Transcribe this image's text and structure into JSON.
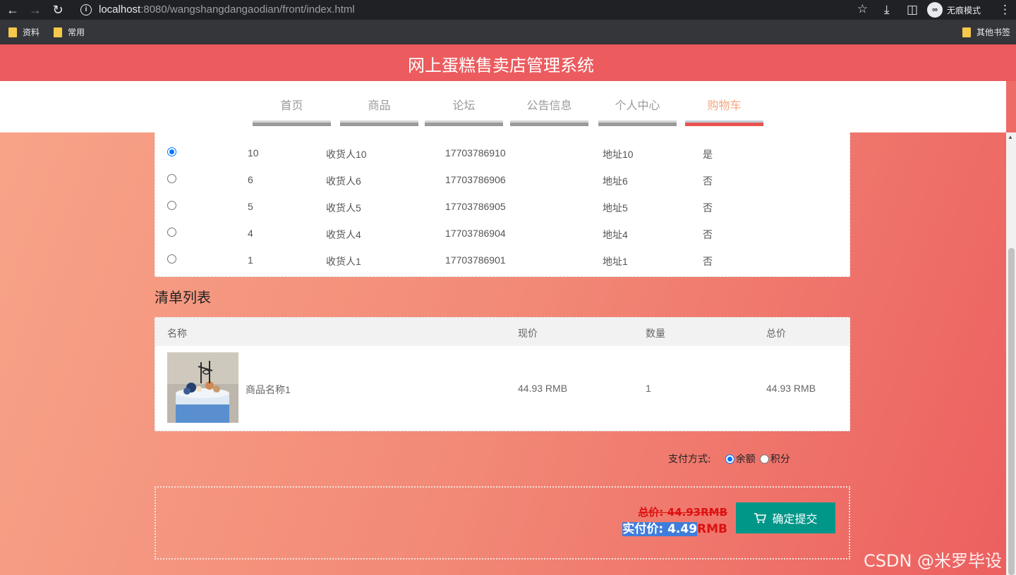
{
  "browser": {
    "url_host": "localhost",
    "url_path": ":8080/wangshangdangaodian/front/index.html",
    "incognito_label": "无痕模式",
    "bookmarks": [
      "资料",
      "常用"
    ],
    "other_bookmarks": "其他书签"
  },
  "site": {
    "title": "网上蛋糕售卖店管理系统",
    "nav": [
      "首页",
      "商品",
      "论坛",
      "公告信息",
      "个人中心",
      "购物车"
    ],
    "active_nav": "购物车"
  },
  "addresses": [
    {
      "id": "10",
      "name": "收货人10",
      "phone": "17703786910",
      "address": "地址10",
      "default": "是",
      "selected": true
    },
    {
      "id": "6",
      "name": "收货人6",
      "phone": "17703786906",
      "address": "地址6",
      "default": "否",
      "selected": false
    },
    {
      "id": "5",
      "name": "收货人5",
      "phone": "17703786905",
      "address": "地址5",
      "default": "否",
      "selected": false
    },
    {
      "id": "4",
      "name": "收货人4",
      "phone": "17703786904",
      "address": "地址4",
      "default": "否",
      "selected": false
    },
    {
      "id": "1",
      "name": "收货人1",
      "phone": "17703786901",
      "address": "地址1",
      "default": "否",
      "selected": false
    }
  ],
  "order_list": {
    "title": "清单列表",
    "headers": {
      "name": "名称",
      "price": "现价",
      "qty": "数量",
      "total": "总价"
    },
    "items": [
      {
        "name": "商品名称1",
        "price": "44.93 RMB",
        "qty": "1",
        "total": "44.93 RMB"
      }
    ]
  },
  "payment": {
    "label": "支付方式:",
    "options": [
      "余额",
      "积分"
    ],
    "selected": "余额"
  },
  "summary": {
    "total_label": "总价: 44.93RMB",
    "real_prefix": "实付价: 4.49",
    "real_suffix": "RMB",
    "submit_label": "确定提交"
  },
  "watermark": "CSDN @米罗毕设",
  "colors": {
    "header": "#ec5b5e",
    "accent": "#009688",
    "active_nav": "#f5a67d",
    "price_red": "#dd1111"
  }
}
